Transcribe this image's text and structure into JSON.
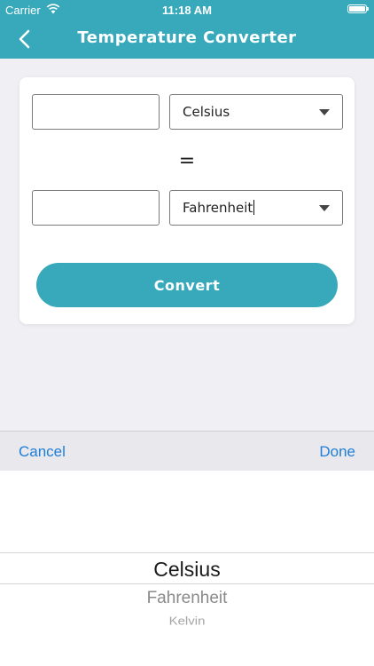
{
  "status_bar": {
    "carrier": "Carrier",
    "time": "11:18 AM"
  },
  "nav": {
    "title": "Temperature Converter"
  },
  "converter": {
    "from_value": "",
    "from_unit": "Celsius",
    "equals": "=",
    "to_value": "",
    "to_unit": "Fahrenheit",
    "convert_label": "Convert"
  },
  "picker_toolbar": {
    "cancel_label": "Cancel",
    "done_label": "Done"
  },
  "picker": {
    "options": [
      "Celsius",
      "Fahrenheit",
      "Kelvin"
    ],
    "selected": "Celsius"
  },
  "colors": {
    "accent": "#37a9bb",
    "link": "#1f7ed6",
    "background": "#efeff4"
  },
  "icons": {
    "back": "chevron-left-icon",
    "wifi": "wifi-icon",
    "battery": "battery-icon",
    "dropdown": "caret-down-icon"
  }
}
